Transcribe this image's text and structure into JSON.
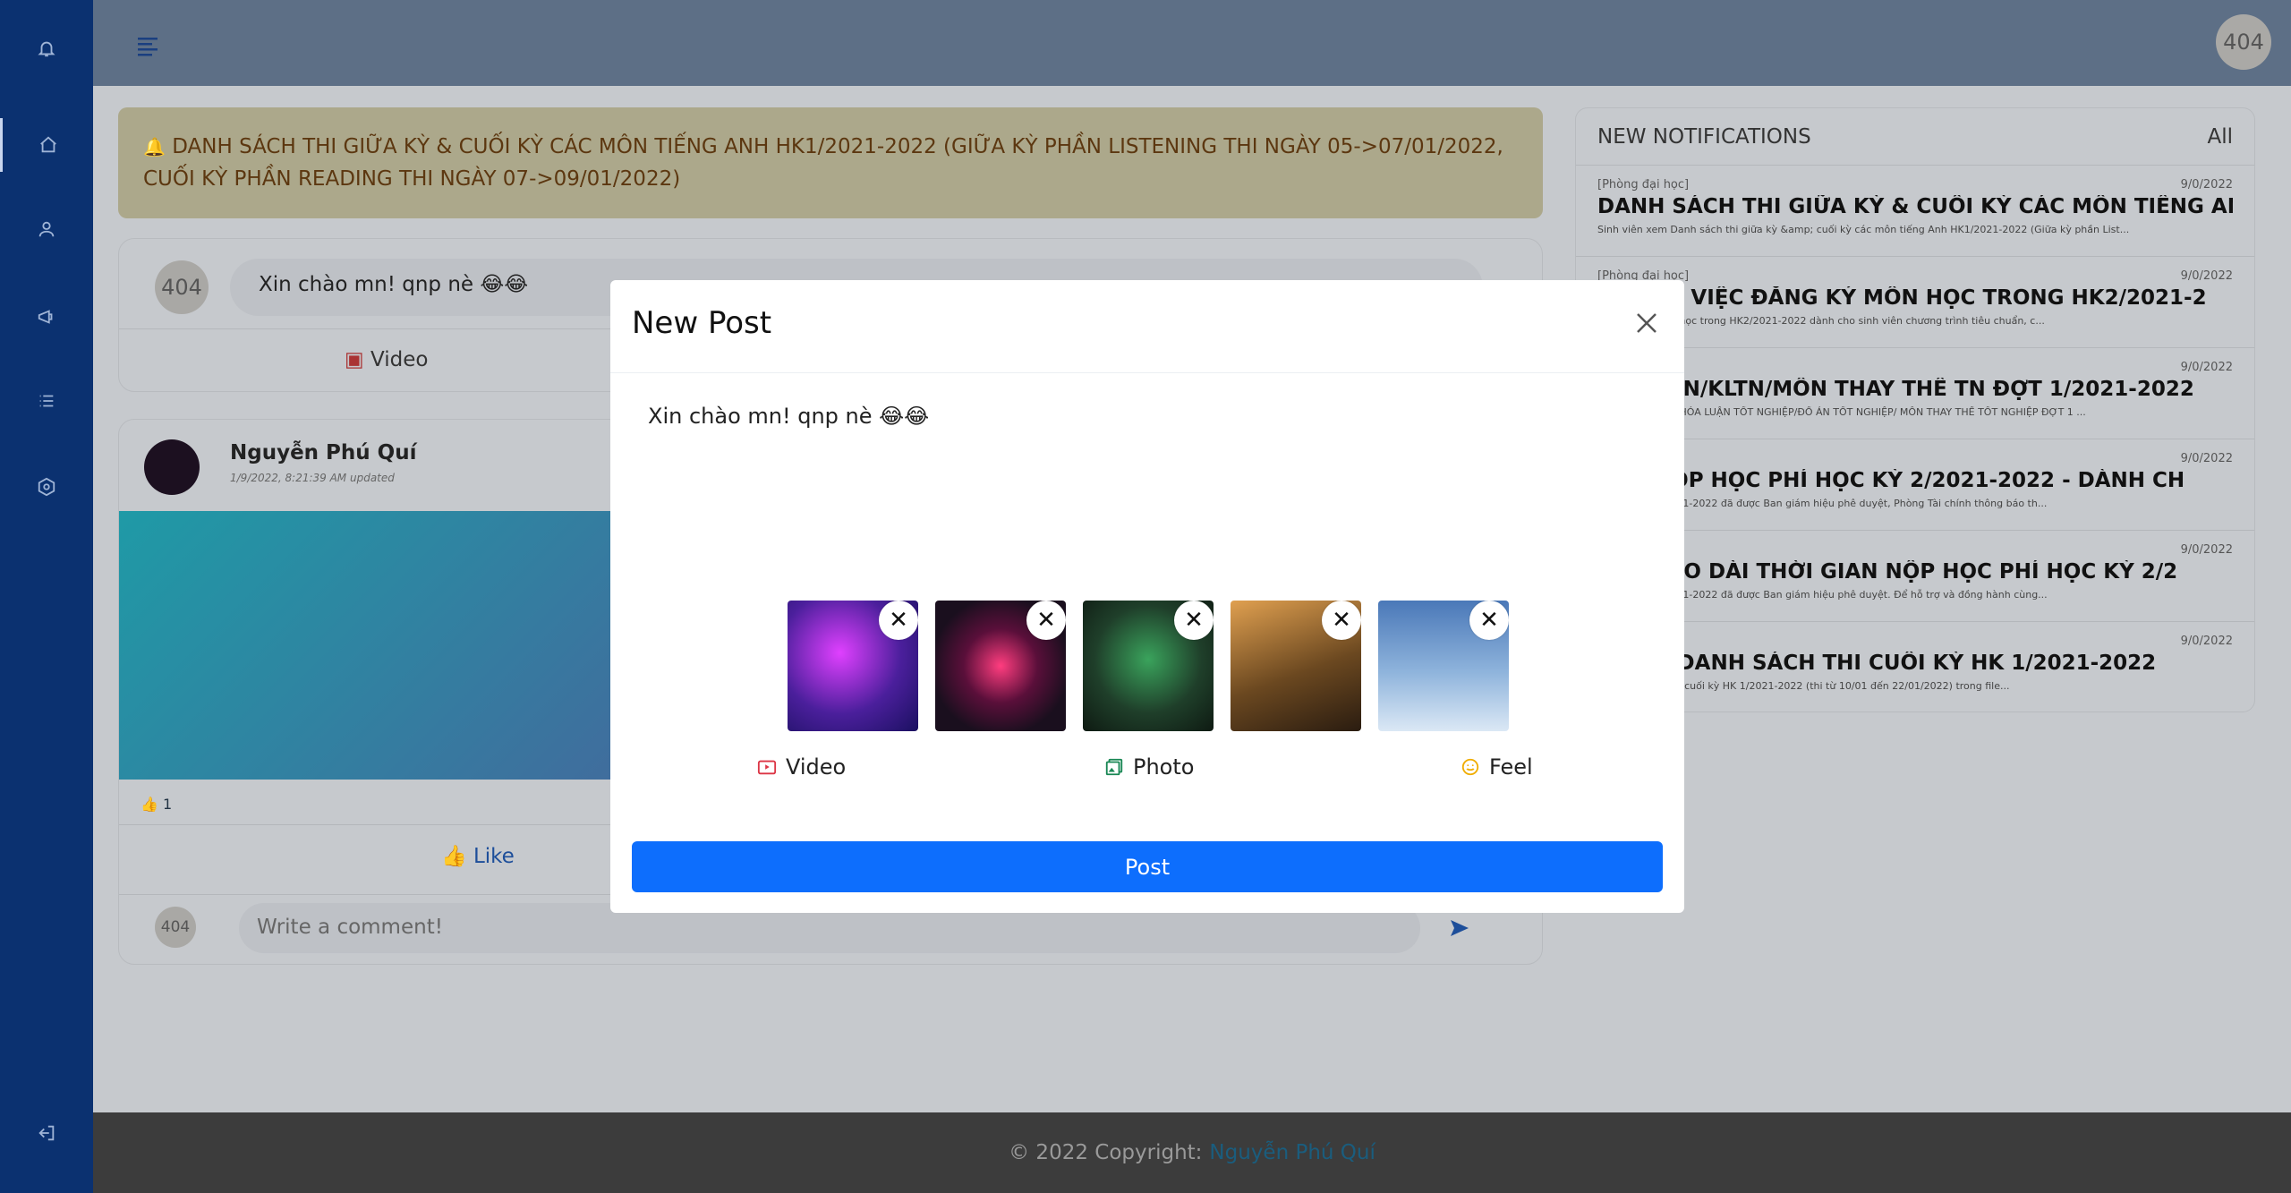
{
  "announcement": "DANH SÁCH THI GIỮA KỲ & CUỐI KỲ CÁC MÔN TIẾNG ANH HK1/2021-2022 (GIỮA KỲ PHẦN LISTENING THI NGÀY 05->07/01/2022, CUỐI KỲ PHẦN READING THI NGÀY 07->09/01/2022)",
  "avatar_text": "404",
  "composer": {
    "text": "Xin chào mn! qnp nè 😂😂",
    "video_label": "Video"
  },
  "post": {
    "author": "Nguyễn Phú Quí",
    "meta": "1/9/2022, 8:21:39 AM updated",
    "like_count": "1",
    "like_label": "Like",
    "comment_placeholder": "Write a comment!"
  },
  "notifications": {
    "header": "NEW NOTIFICATIONS",
    "all_label": "All",
    "items": [
      {
        "source": "[Phòng đại học]",
        "date": "9/0/2022",
        "title": "DANH SÁCH THI GIỮA KỲ & CUỐI KỲ CÁC MÔN TIẾNG ANH",
        "summary": "Sinh viên xem Danh sách thi giữa kỳ &amp; cuối kỳ các môn tiếng Anh HK1/2021-2022 (Giữa kỳ phần List..."
      },
      {
        "source": "[Phòng đại học]",
        "date": "9/0/2022",
        "title": "BÁO VỀ VIỆC ĐĂNG KÝ MÔN HỌC TRONG HK2/2021-2",
        "summary": "ệc đăng ký môn học trong HK2/2021-2022 dành cho sinh viên chương trình tiêu chuẩn, c..."
      },
      {
        "source": "]",
        "date": "9/0/2022",
        "title": "CH TSNN/KLTN/MÔN THAY THẾ TN ĐỢT 1/2021-2022",
        "summary": "NGHỆ NGHIỆP, KHÓA LUẬN TỐT NGHIỆP/ĐỒ ÁN TỐT NGHIỆP/ MÔN THAY THẾ TỐT NGHIỆP ĐỢT 1 ..."
      },
      {
        "source": "h]",
        "date": "9/0/2022",
        "title": "BÁO NỘP HỌC PHÍ HỌC KỲ 2/2021-2022 - DÀNH CH",
        "summary": "ách năm học 2021-2022 đã được Ban giám hiệu phê duyệt, Phòng Tài chính thông báo th..."
      },
      {
        "source": "h]",
        "date": "9/0/2022",
        "title": "BÁO KÉO DÀI THỜI GIAN NỘP HỌC PHÍ HỌC KỲ 2/2",
        "summary": "ách năm học 2021-2022 đã được Ban giám hiệu phê duyệt. Để hỗ trợ và đồng hành cùng..."
      },
      {
        "source": "]",
        "date": "9/0/2022",
        "title": "THỨC] DANH SÁCH THI CUỐI KỲ HK 1/2021-2022",
        "summary": "iết Danh sách thi cuối kỳ HK 1/2021-2022 (thi từ 10/01 đến 22/01/2022) trong file..."
      }
    ]
  },
  "footer": {
    "copyright": "© 2022 Copyright:",
    "author_link": "Nguyễn Phú Quí"
  },
  "modal": {
    "title": "New Post",
    "text": "Xin chào mn! qnp nè 😂😂",
    "remove_symbol": "✕",
    "actions": {
      "video": "Video",
      "photo": "Photo",
      "feel": "Feel"
    },
    "post_button": "Post",
    "thumb_colors": [
      "#4b1f9c",
      "#1a0f1e",
      "#1f3f2a",
      "#6b4820",
      "#8fb4dc"
    ]
  }
}
